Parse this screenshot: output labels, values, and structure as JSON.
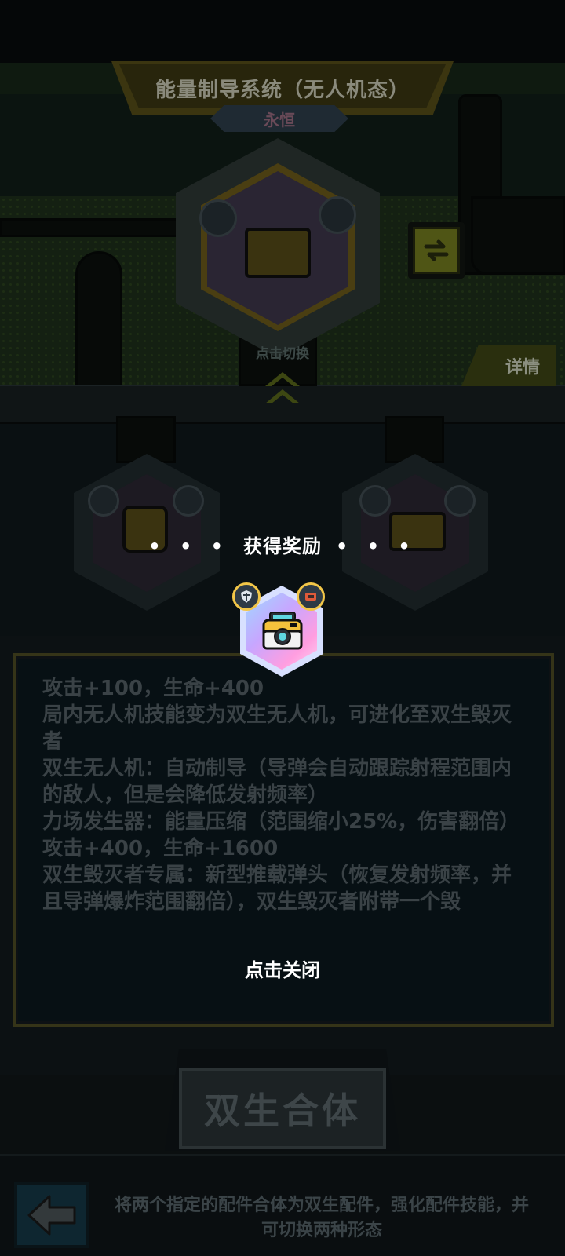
{
  "header": {
    "title": "能量制导系统（无人机态）",
    "rarity": "永恒",
    "tap_switch_hint": "点击切换",
    "details_label": "详情"
  },
  "reward_overlay": {
    "dots_left": "• • •",
    "title": "获得奖励",
    "dots_right": "• • •",
    "item_icon": "drone-camera-icon",
    "close_hint": "点击关闭"
  },
  "description": {
    "lines": [
      "攻击+100，生命+400",
      "",
      "局内无人机技能变为双生无人机，可进化至双生毁灭者",
      "双生无人机：自动制导（导弹会自动跟踪射程范围内的敌人，但是会降低发射频率）",
      "力场发生器：能量压缩（范围缩小25%，伤害翻倍）",
      "",
      "攻击+400，生命+1600",
      "",
      "双生毁灭者专属：新型推载弹头（恢复发射频率，并且导弹爆炸范围翻倍），双生毁灭者附带一个毁"
    ]
  },
  "merge_button": {
    "label": "双生合体"
  },
  "footer": {
    "back_icon": "arrow-left-icon",
    "description": "将两个指定的配件合体为双生配件，强化配件技能，并可切换两种形态"
  },
  "colors": {
    "accent_gold": "#f2c648",
    "dim_text": "#3a4246",
    "overlay_text": "#ffffff"
  }
}
